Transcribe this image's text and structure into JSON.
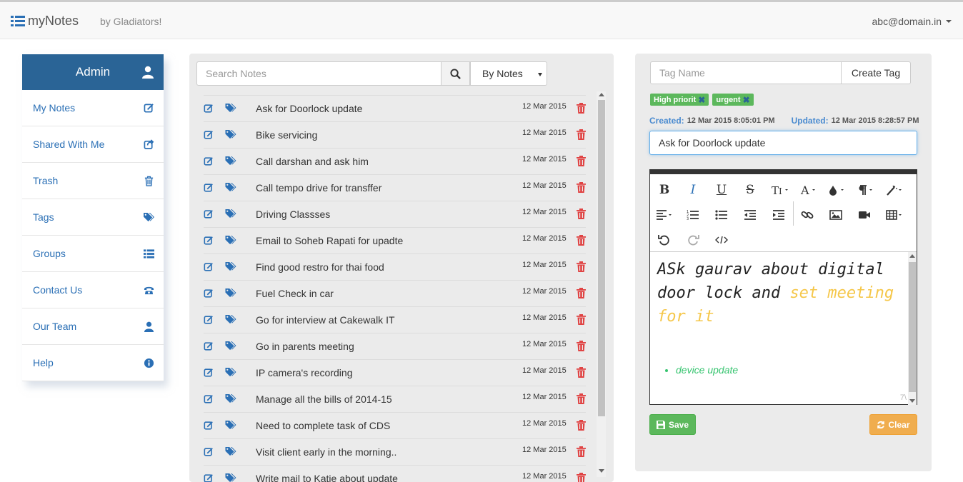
{
  "navbar": {
    "brand": "myNotes",
    "tagline": "by Gladiators!",
    "user_email": "abc@domain.in"
  },
  "sidebar": {
    "header": "Admin",
    "items": [
      {
        "label": "My Notes",
        "icon": "edit-icon"
      },
      {
        "label": "Shared With Me",
        "icon": "share-icon"
      },
      {
        "label": "Trash",
        "icon": "trash-icon"
      },
      {
        "label": "Tags",
        "icon": "tags-icon"
      },
      {
        "label": "Groups",
        "icon": "list-icon"
      },
      {
        "label": "Contact Us",
        "icon": "phone-icon"
      },
      {
        "label": "Our Team",
        "icon": "user-icon"
      },
      {
        "label": "Help",
        "icon": "info-icon"
      }
    ]
  },
  "notes": {
    "search_placeholder": "Search Notes",
    "filter_value": "By Notes",
    "rows": [
      {
        "title": "Ask for Doorlock update",
        "date": "12 Mar 2015"
      },
      {
        "title": "Bike servicing",
        "date": "12 Mar 2015"
      },
      {
        "title": "Call darshan and ask him",
        "date": "12 Mar 2015"
      },
      {
        "title": "Call tempo drive for transffer",
        "date": "12 Mar 2015"
      },
      {
        "title": "Driving Classses",
        "date": "12 Mar 2015"
      },
      {
        "title": "Email to Soheb Rapati for upadte",
        "date": "12 Mar 2015"
      },
      {
        "title": "Find good restro for thai food",
        "date": "12 Mar 2015"
      },
      {
        "title": "Fuel Check in car",
        "date": "12 Mar 2015"
      },
      {
        "title": "Go for interview at Cakewalk IT",
        "date": "12 Mar 2015"
      },
      {
        "title": "Go in parents meeting",
        "date": "12 Mar 2015"
      },
      {
        "title": "IP camera's recording",
        "date": "12 Mar 2015"
      },
      {
        "title": "Manage all the bills of 2014-15",
        "date": "12 Mar 2015"
      },
      {
        "title": "Need to complete task of CDS",
        "date": "12 Mar 2015"
      },
      {
        "title": "Visit client early in the morning..",
        "date": "12 Mar 2015"
      },
      {
        "title": "Write mail to Katie about update",
        "date": "12 Mar 2015"
      }
    ]
  },
  "editor": {
    "tag_placeholder": "Tag Name",
    "create_tag_label": "Create Tag",
    "tags": [
      "High priorit",
      "urgent"
    ],
    "created_label": "Created:",
    "created_value": "12 Mar 2015 8:05:01 PM",
    "updated_label": "Updated:",
    "updated_value": "12 Mar 2015 8:28:57 PM",
    "title_value": "Ask for Doorlock update",
    "body_text_plain": "ASk gaurav about digital door lock and",
    "body_text_highlight": "set meeting for it",
    "body_bullet": "device update",
    "resize_hint": "7\\",
    "save_label": "Save",
    "clear_label": "Clear",
    "highlight_color": "#f5c74a",
    "bullet_color": "#36c46f"
  },
  "colors": {
    "primary": "#2a6496",
    "link": "#2a6fb5",
    "success": "#5cb85c",
    "warning": "#f0ad4e",
    "danger": "#e04343"
  }
}
